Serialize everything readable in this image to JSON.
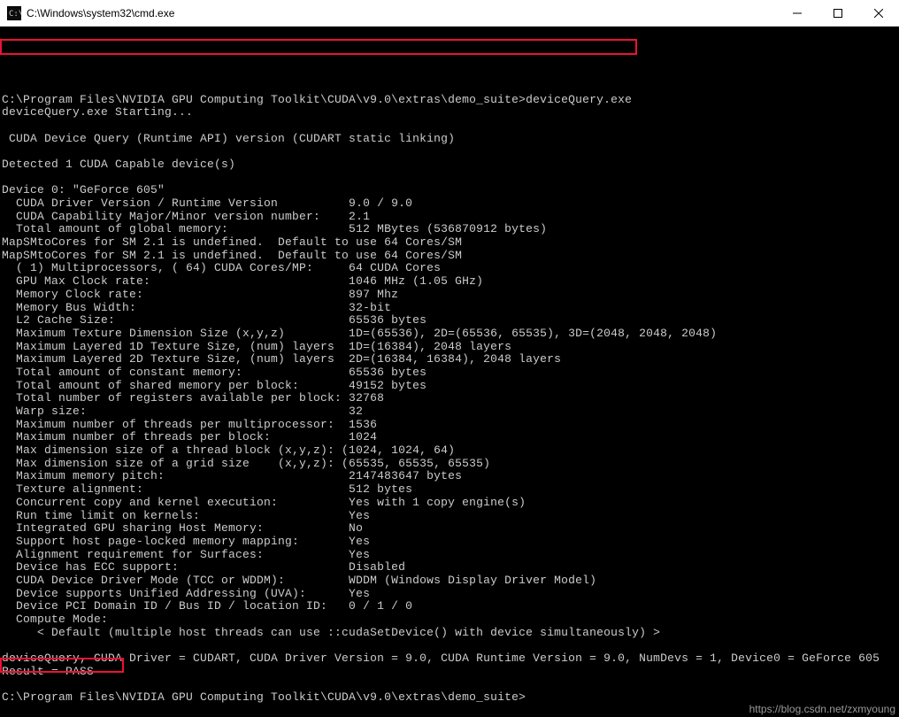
{
  "window": {
    "title": "C:\\Windows\\system32\\cmd.exe",
    "icon_label": "cmd"
  },
  "highlights": {
    "prompt_cmd": "C:\\Program Files\\NVIDIA GPU Computing Toolkit\\CUDA\\v9.0\\extras\\demo_suite>deviceQuery.exe",
    "result_pass": "Result = PASS"
  },
  "watermark": "https://blog.csdn.net/zxmyoung",
  "terminal": {
    "lines": [
      "",
      "C:\\Program Files\\NVIDIA GPU Computing Toolkit\\CUDA\\v9.0\\extras\\demo_suite>deviceQuery.exe",
      "deviceQuery.exe Starting...",
      "",
      " CUDA Device Query (Runtime API) version (CUDART static linking)",
      "",
      "Detected 1 CUDA Capable device(s)",
      "",
      "Device 0: \"GeForce 605\"",
      "  CUDA Driver Version / Runtime Version          9.0 / 9.0",
      "  CUDA Capability Major/Minor version number:    2.1",
      "  Total amount of global memory:                 512 MBytes (536870912 bytes)",
      "MapSMtoCores for SM 2.1 is undefined.  Default to use 64 Cores/SM",
      "MapSMtoCores for SM 2.1 is undefined.  Default to use 64 Cores/SM",
      "  ( 1) Multiprocessors, ( 64) CUDA Cores/MP:     64 CUDA Cores",
      "  GPU Max Clock rate:                            1046 MHz (1.05 GHz)",
      "  Memory Clock rate:                             897 Mhz",
      "  Memory Bus Width:                              32-bit",
      "  L2 Cache Size:                                 65536 bytes",
      "  Maximum Texture Dimension Size (x,y,z)         1D=(65536), 2D=(65536, 65535), 3D=(2048, 2048, 2048)",
      "  Maximum Layered 1D Texture Size, (num) layers  1D=(16384), 2048 layers",
      "  Maximum Layered 2D Texture Size, (num) layers  2D=(16384, 16384), 2048 layers",
      "  Total amount of constant memory:               65536 bytes",
      "  Total amount of shared memory per block:       49152 bytes",
      "  Total number of registers available per block: 32768",
      "  Warp size:                                     32",
      "  Maximum number of threads per multiprocessor:  1536",
      "  Maximum number of threads per block:           1024",
      "  Max dimension size of a thread block (x,y,z): (1024, 1024, 64)",
      "  Max dimension size of a grid size    (x,y,z): (65535, 65535, 65535)",
      "  Maximum memory pitch:                          2147483647 bytes",
      "  Texture alignment:                             512 bytes",
      "  Concurrent copy and kernel execution:          Yes with 1 copy engine(s)",
      "  Run time limit on kernels:                     Yes",
      "  Integrated GPU sharing Host Memory:            No",
      "  Support host page-locked memory mapping:       Yes",
      "  Alignment requirement for Surfaces:            Yes",
      "  Device has ECC support:                        Disabled",
      "  CUDA Device Driver Mode (TCC or WDDM):         WDDM (Windows Display Driver Model)",
      "  Device supports Unified Addressing (UVA):      Yes",
      "  Device PCI Domain ID / Bus ID / location ID:   0 / 1 / 0",
      "  Compute Mode:",
      "     < Default (multiple host threads can use ::cudaSetDevice() with device simultaneously) >",
      "",
      "deviceQuery, CUDA Driver = CUDART, CUDA Driver Version = 9.0, CUDA Runtime Version = 9.0, NumDevs = 1, Device0 = GeForce 605",
      "Result = PASS",
      "",
      "C:\\Program Files\\NVIDIA GPU Computing Toolkit\\CUDA\\v9.0\\extras\\demo_suite>"
    ]
  }
}
